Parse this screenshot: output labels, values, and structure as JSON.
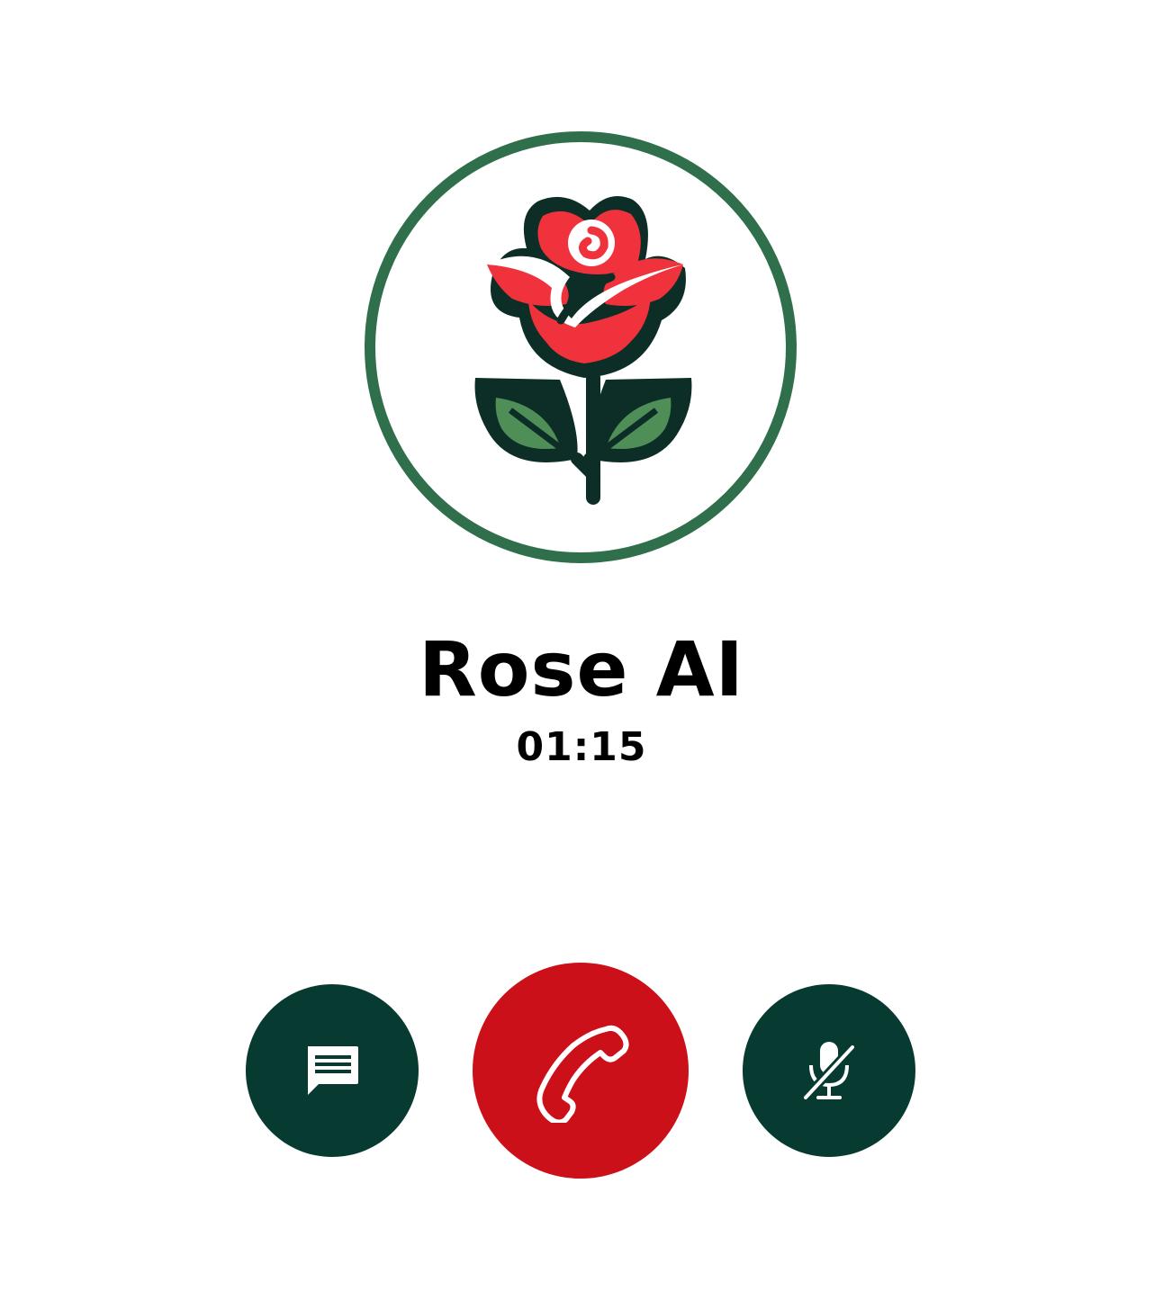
{
  "call": {
    "contact_name": "Rose AI",
    "timer": "01:15"
  },
  "avatar": {
    "icon": "rose-icon",
    "ring_color": "#2f6f4b"
  },
  "controls": {
    "chat": {
      "icon": "chat-message-icon",
      "color": "#073b32"
    },
    "end_call": {
      "icon": "phone-hangup-icon",
      "color": "#cc101a"
    },
    "mute": {
      "icon": "microphone-muted-icon",
      "color": "#073b32"
    }
  },
  "colors": {
    "background": "#ffffff",
    "text": "#000000",
    "rose_red": "#f0323c",
    "leaf_green": "#4f8f57",
    "outline_dark": "#0d2e27"
  }
}
